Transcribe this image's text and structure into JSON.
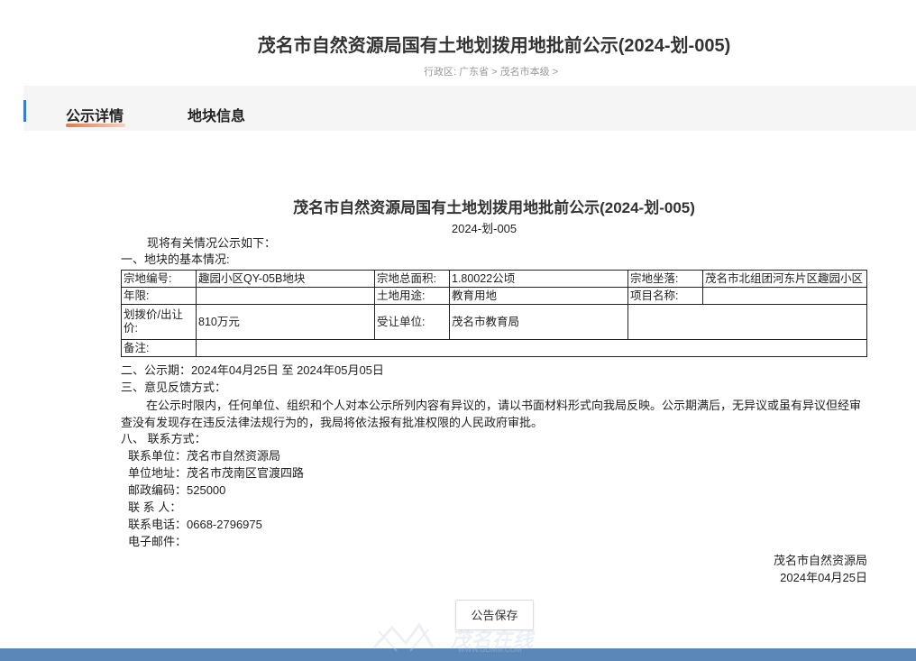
{
  "header": {
    "title": "茂名市自然资源局国有土地划拨用地批前公示(2024-划-005)",
    "breadcrumb": "行政区:  广东省 > 茂名市本级 >"
  },
  "tabs": [
    {
      "label": "公示详情"
    },
    {
      "label": "地块信息"
    }
  ],
  "document": {
    "title": "茂名市自然资源局国有土地划拨用地批前公示(2024-划-005)",
    "number": "2024-划-005",
    "intro": "现将有关情况公示如下：",
    "section1": "一、地块的基本情况:",
    "table": {
      "r1": [
        "宗地编号:",
        "趣园小区QY-05B地块",
        "宗地总面积:",
        "1.80022公顷",
        "宗地坐落:",
        "茂名市北组团河东片区趣园小区"
      ],
      "r2": [
        "年限:",
        "",
        "土地用途:",
        "教育用地",
        "项目名称:",
        ""
      ],
      "r3": [
        "划拨价/出让价:",
        "810万元",
        "受让单位:",
        "茂名市教育局",
        ""
      ],
      "r4": [
        "备注:",
        ""
      ]
    },
    "section2": "二、公示期：2024年04月25日 至 2024年05月05日",
    "section3": "三、意见反馈方式：",
    "section3_text": "在公示时限内，任何单位、组织和个人对本公示所列内容有异议的，请以书面材料形式向我局反映。公示期满后，无异议或虽有异议但经审查没有发现存在违反法律法规行为的，我局将依法报有批准权限的人民政府审批。",
    "section8": "八、 联系方式：",
    "contact": [
      {
        "label": "联系单位：",
        "value": "茂名市自然资源局"
      },
      {
        "label": "单位地址：",
        "value": "茂名市茂南区官渡四路"
      },
      {
        "label": "邮政编码：",
        "value": "525000"
      },
      {
        "label": "联 系 人：",
        "value": ""
      },
      {
        "label": "联系电话：",
        "value": "0668-2796975"
      },
      {
        "label": "电子邮件：",
        "value": ""
      }
    ],
    "signer": "茂名市自然资源局",
    "sign_date": "2024年04月25日"
  },
  "actions": {
    "save_label": "公告保存"
  },
  "watermark": {
    "text": "茂名在线",
    "url": "WWW.GDMM.COM"
  },
  "colors": {
    "accent_blue": "#3a7bd5",
    "tab_underline": "#e07b4f",
    "footer_bar": "#5b87b8"
  }
}
